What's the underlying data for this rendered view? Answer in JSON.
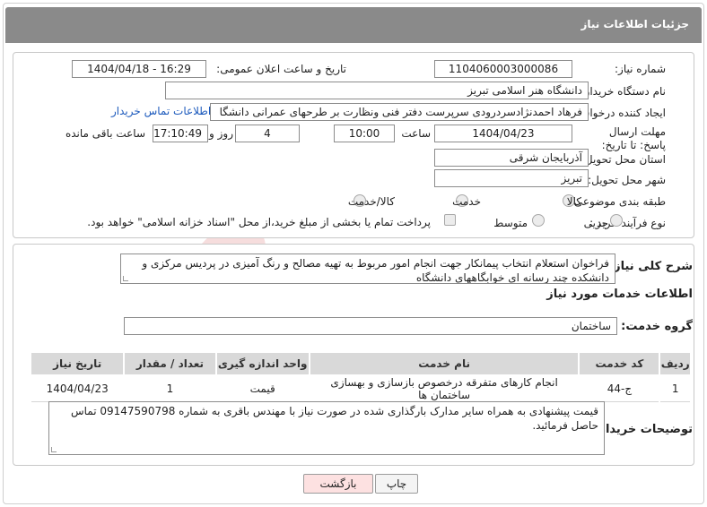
{
  "header": {
    "title": "جزئیات اطلاعات نیاز"
  },
  "details": {
    "need_number_label": "شماره نیاز:",
    "need_number": "1104060003000086",
    "announce_label": "تاریخ و ساعت اعلان عمومی:",
    "announce_value": "1404/04/18 - 16:29",
    "buyer_org_label": "نام دستگاه خریدار:",
    "buyer_org": "دانشگاه هنر اسلامی تبریز",
    "requester_label": "ایجاد کننده درخواست:",
    "requester": "فرهاد احمدنژادسردرودی سرپرست دفتر فنی ونظارت بر طرحهای عمرانی دانشگا",
    "contact_link": "اطلاعات تماس خریدار",
    "deadline_label": "مهلت ارسال پاسخ: تا تاریخ:",
    "deadline_date": "1404/04/23",
    "time_label": "ساعت",
    "deadline_time": "10:00",
    "days_value": "4",
    "days_label": "روز و",
    "remaining_time": "17:10:49",
    "remaining_label": "ساعت باقی مانده",
    "province_label": "استان محل تحویل:",
    "province": "آذربایجان شرقی",
    "city_label": "شهر محل تحویل:",
    "city": "تبریز",
    "category_label": "طبقه بندی موضوعی:",
    "category_options": [
      "کالا",
      "خدمت",
      "کالا/خدمت"
    ],
    "process_label": "نوع فرآیند خرید :",
    "process_options": [
      "جزیی",
      "متوسط"
    ],
    "payment_note": "پرداخت تمام یا بخشی از مبلغ خرید،از محل \"اسناد خزانه اسلامی\" خواهد بود."
  },
  "summary": {
    "label": "شرح کلی نیاز:",
    "text": "فراخوان استعلام انتخاب پیمانکار جهت انجام امور مربوط به تهیه مصالح و رنگ آمیزی در پردیس مرکزی و دانشکده چند رسانه ای خوابگاههای دانشگاه"
  },
  "services": {
    "section_title": "اطلاعات خدمات مورد نیاز",
    "group_label": "گروه خدمت:",
    "group_value": "ساختمان",
    "columns": [
      "ردیف",
      "کد خدمت",
      "نام خدمت",
      "واحد اندازه گیری",
      "تعداد / مقدار",
      "تاریخ نیاز"
    ],
    "rows": [
      [
        "1",
        "ج-44",
        "انجام کارهای متفرقه درخصوص بازسازی و بهسازی ساختمان ها",
        "قیمت",
        "1",
        "1404/04/23"
      ]
    ]
  },
  "buyer_notes": {
    "label": "توضیحات خریدار:",
    "text": "قیمت پیشنهادی به همراه سایر مدارک بارگذاری شده در صورت نیاز با مهندس باقری به شماره 09147590798 تماس حاصل فرمائید."
  },
  "buttons": {
    "print": "چاپ",
    "back": "بازگشت"
  },
  "watermark": {
    "brand_text": "AriaTender.net"
  }
}
